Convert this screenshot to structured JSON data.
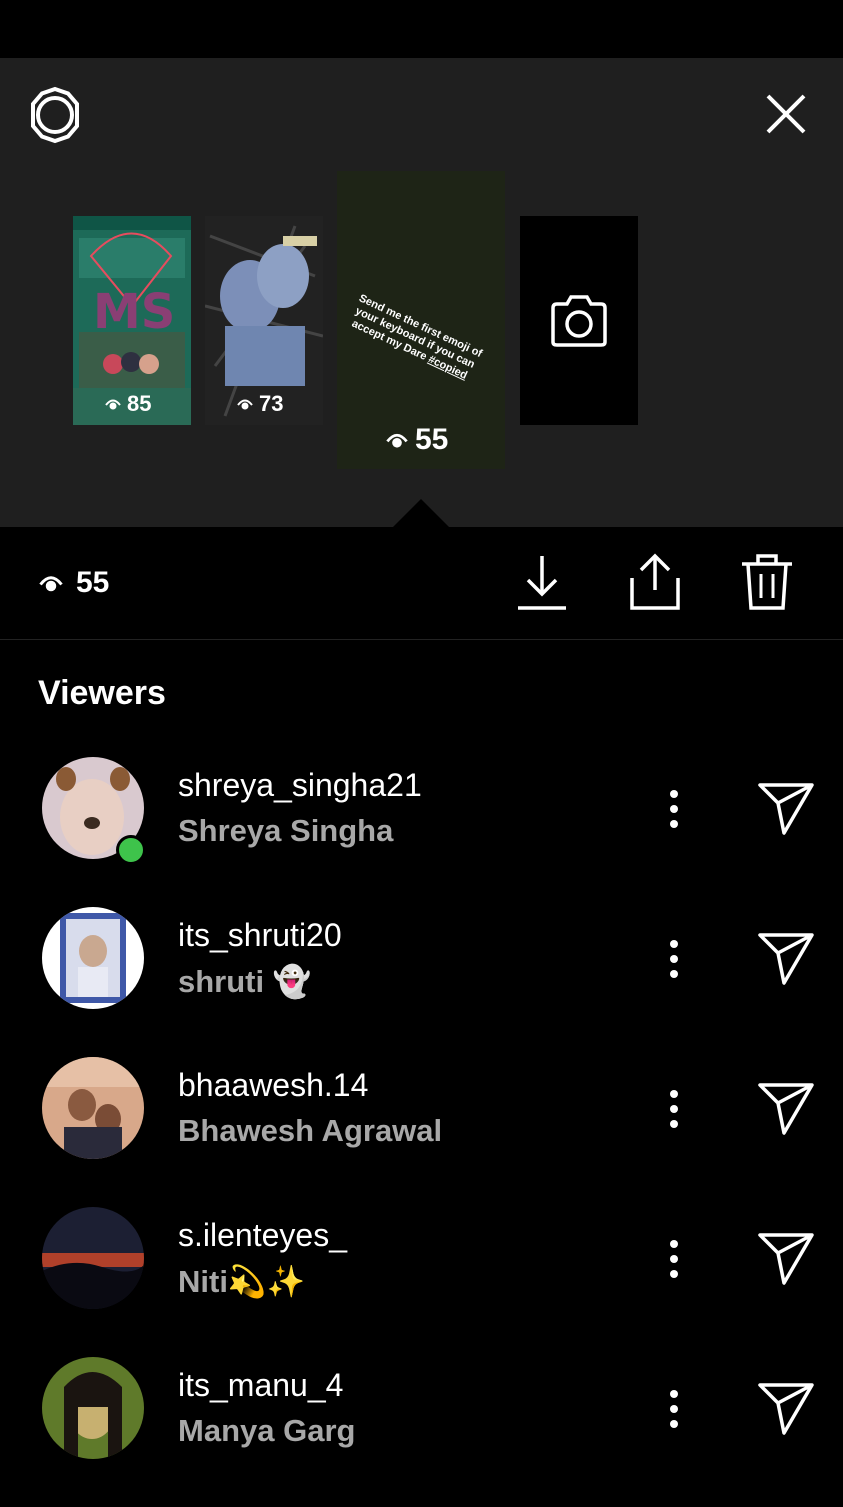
{
  "story_thumbnails": [
    {
      "views": "85"
    },
    {
      "views": "73"
    },
    {
      "views": "55",
      "text": "Send me the first emoji of your keyboard if you can accept my Dare",
      "hashtag": "#copied"
    },
    {
      "icon": "camera-icon"
    }
  ],
  "header": {
    "settings_icon": "gear-icon",
    "close_icon": "close-icon"
  },
  "toolbar": {
    "view_count": "55",
    "download_icon": "download-icon",
    "share_icon": "share-icon",
    "delete_icon": "trash-icon"
  },
  "viewers": {
    "title": "Viewers",
    "items": [
      {
        "username": "shreya_singha21",
        "full_name": "Shreya Singha",
        "online": true
      },
      {
        "username": "its_shruti20",
        "full_name": "shruti 👻",
        "online": false
      },
      {
        "username": "bhaawesh.14",
        "full_name": "Bhawesh Agrawal",
        "online": false
      },
      {
        "username": "s.ilenteyes_",
        "full_name": "Niti💫✨",
        "online": false
      },
      {
        "username": "its_manu_4",
        "full_name": "Manya Garg",
        "online": false
      }
    ]
  },
  "colors": {
    "panel_bg": "#1f1f1f",
    "online_dot": "#3ec34b",
    "secondary_text": "#a8a8a8"
  }
}
